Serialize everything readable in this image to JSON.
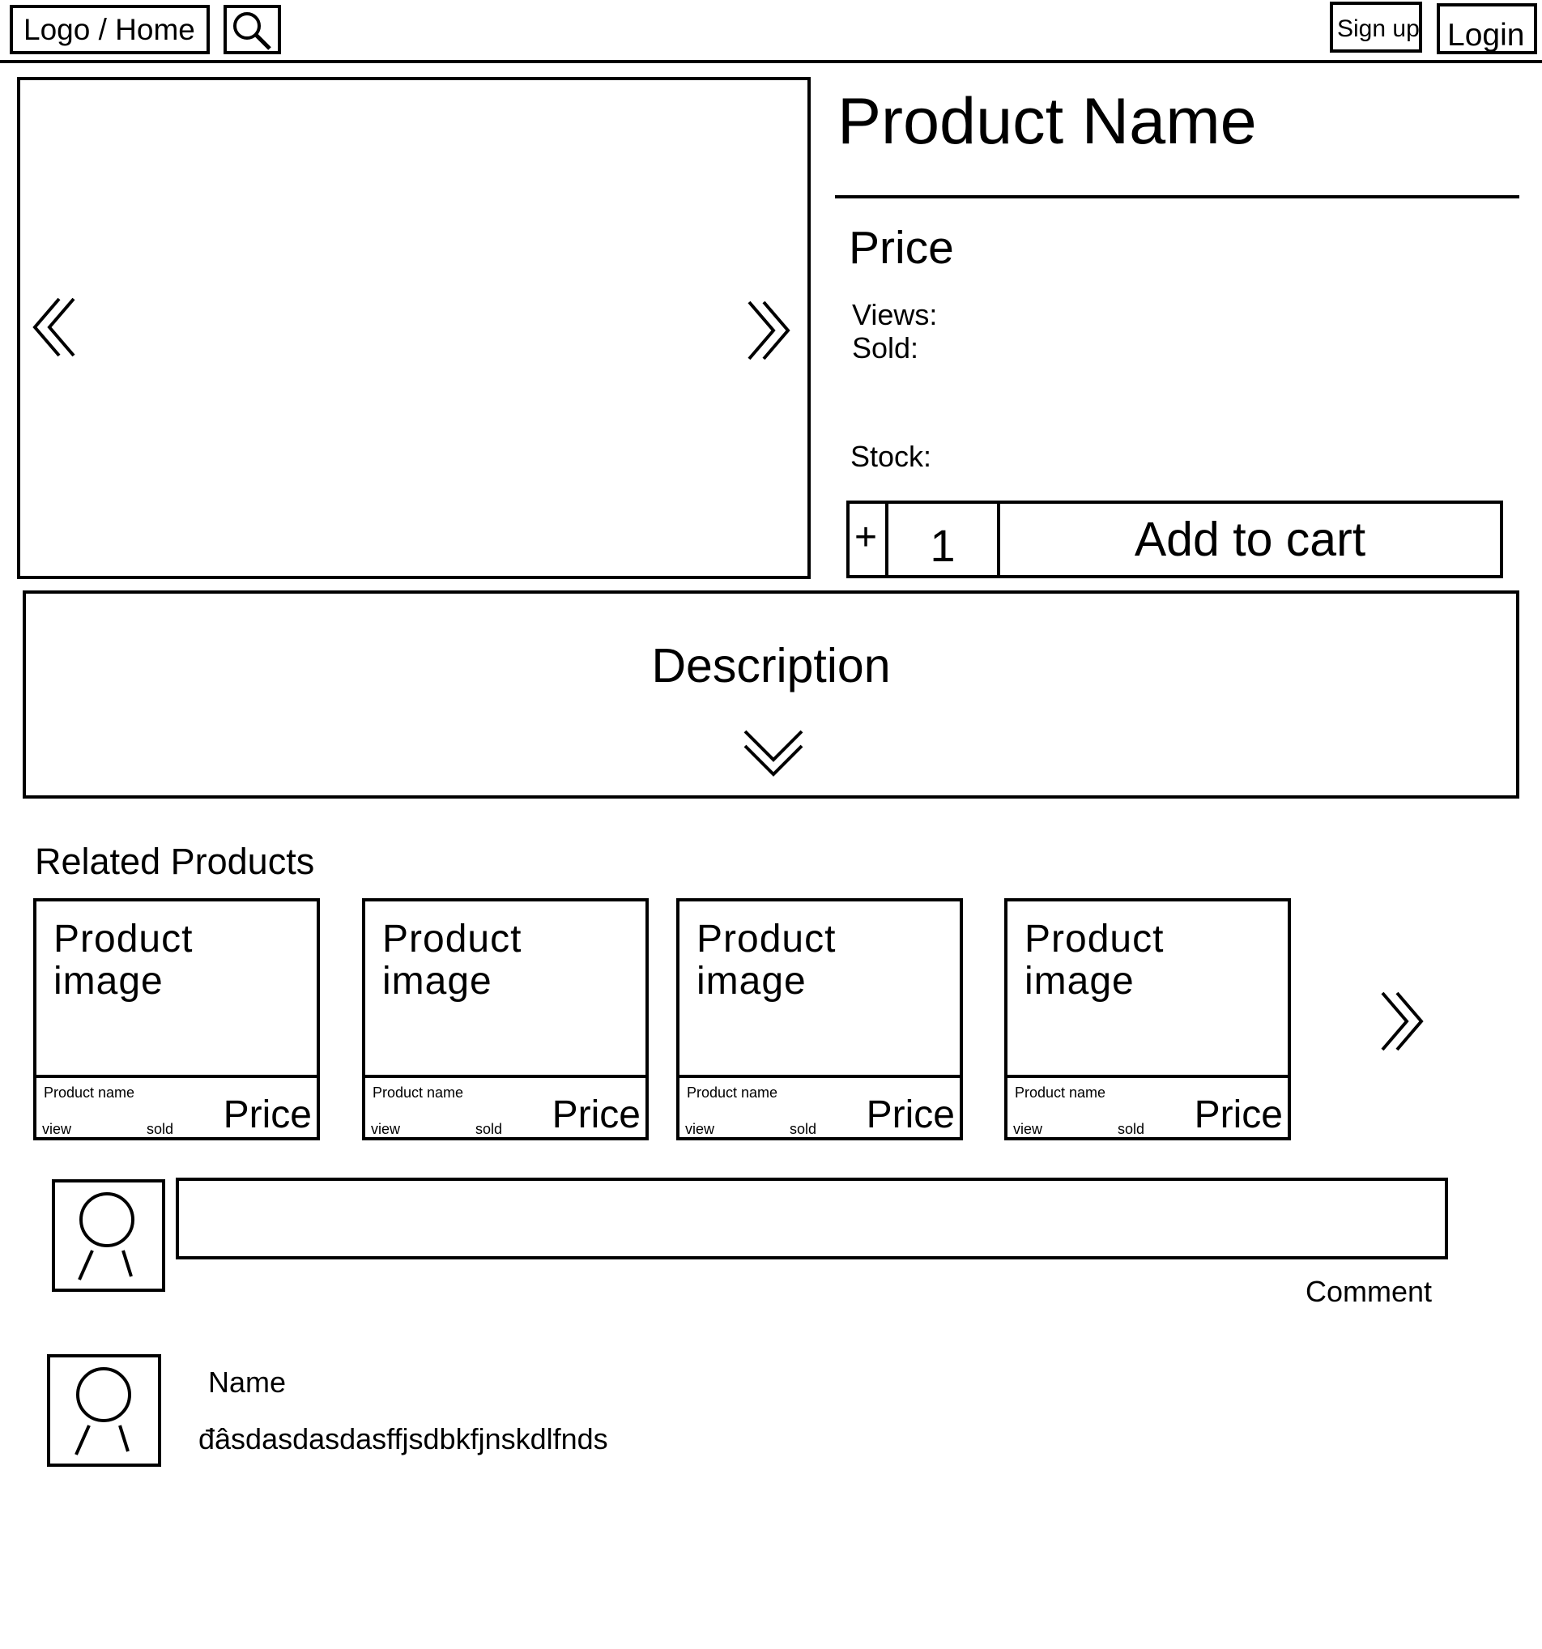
{
  "header": {
    "logo_label": "Logo / Home",
    "signup_label": "Sign up",
    "login_label": "Login",
    "search_icon": "search-icon"
  },
  "product": {
    "name": "Product Name",
    "price_label": "Price",
    "views_label": "Views:",
    "sold_label": "Sold:",
    "stock_label": "Stock:",
    "plus_label": "+",
    "quantity": "1",
    "add_to_cart_label": "Add to cart"
  },
  "description": {
    "label": "Description"
  },
  "related": {
    "title": "Related Products",
    "items": [
      {
        "image_label": "Product image",
        "name": "Product name",
        "view": "view",
        "sold": "sold",
        "price": "Price"
      },
      {
        "image_label": "Product image",
        "name": "Product name",
        "view": "view",
        "sold": "sold",
        "price": "Price"
      },
      {
        "image_label": "Product image",
        "name": "Product name",
        "view": "view",
        "sold": "sold",
        "price": "Price"
      },
      {
        "image_label": "Product image",
        "name": "Product name",
        "view": "view",
        "sold": "sold",
        "price": "Price"
      }
    ]
  },
  "comments": {
    "input_value": "",
    "comment_label": "Comment",
    "list": [
      {
        "name": "Name",
        "text": "đâsdasdasdasffjsdbkfjnskdlfnds"
      }
    ]
  }
}
